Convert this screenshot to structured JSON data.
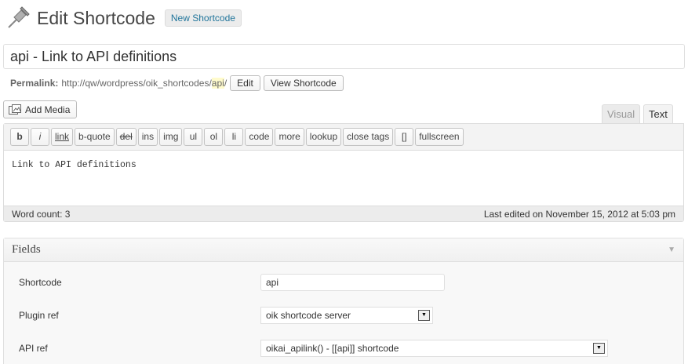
{
  "header": {
    "title": "Edit Shortcode",
    "add_new_label": "New Shortcode"
  },
  "title_field": {
    "value": "api - Link to API definitions"
  },
  "permalink": {
    "label": "Permalink:",
    "url_base": "http://qw/wordpress/oik_shortcodes/",
    "slug": "api",
    "trailing": "/",
    "edit_label": "Edit",
    "view_label": "View Shortcode"
  },
  "media": {
    "add_media_label": "Add Media"
  },
  "editor_tabs": {
    "visual": "Visual",
    "text": "Text"
  },
  "toolbar": {
    "buttons": [
      "b",
      "i",
      "link",
      "b-quote",
      "del",
      "ins",
      "img",
      "ul",
      "ol",
      "li",
      "code",
      "more",
      "lookup",
      "close tags",
      "[]",
      "fullscreen"
    ]
  },
  "editor": {
    "content": "Link to API definitions",
    "word_count": "Word count: 3",
    "last_edited": "Last edited on November 15, 2012 at 5:03 pm"
  },
  "fields_box": {
    "title": "Fields",
    "shortcode_label": "Shortcode",
    "shortcode_value": "api",
    "plugin_ref_label": "Plugin ref",
    "plugin_ref_value": "oik shortcode server",
    "api_ref_label": "API ref",
    "api_ref_value": "oikai_apilink() - [[api]] shortcode"
  },
  "icons": {
    "page": "pushpin-icon",
    "media": "media-icon",
    "box_toggle": "triangle-down-icon",
    "select_arrow": "select-arrow-icon"
  }
}
